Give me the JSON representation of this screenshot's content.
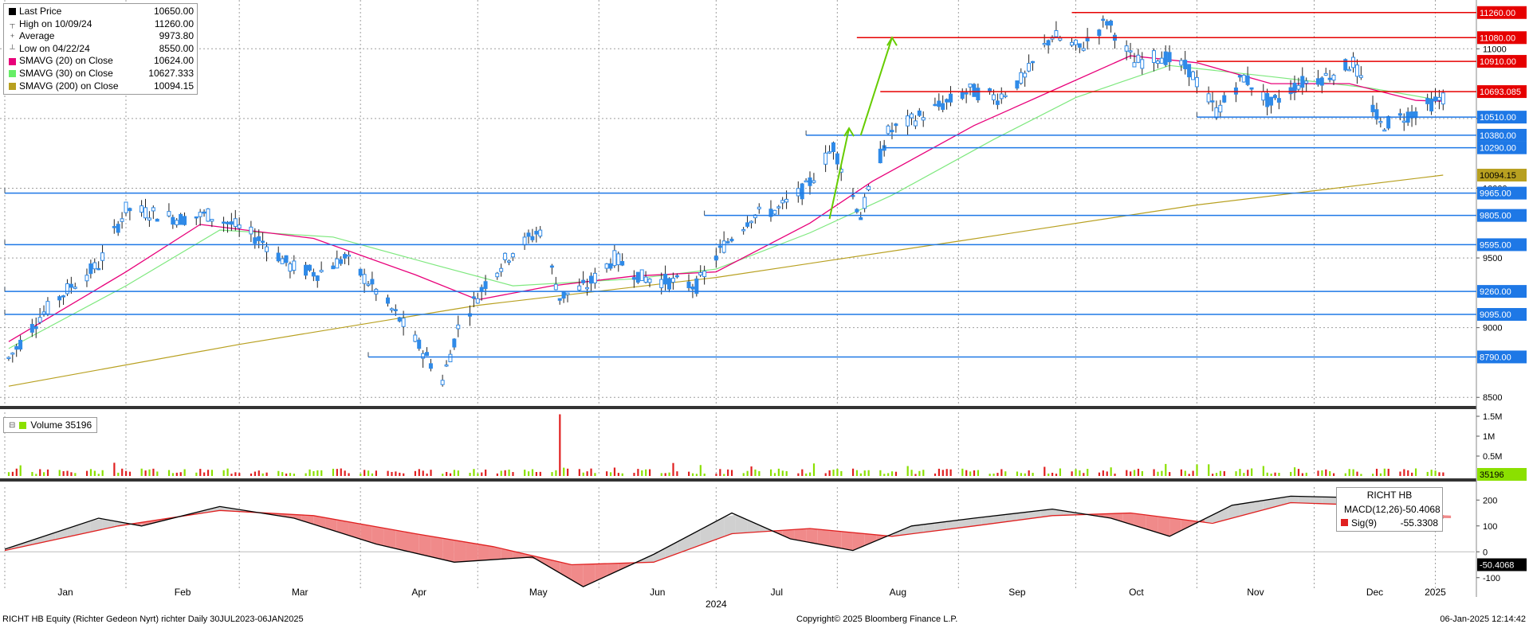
{
  "legend": {
    "items": [
      {
        "label": "Last Price",
        "value": "10650.00",
        "swatch": "#000000",
        "icon": "square"
      },
      {
        "label": "High on 10/09/24",
        "value": "11260.00",
        "icon": "high-marker-icon"
      },
      {
        "label": "Average",
        "value": "9973.80",
        "icon": "average-marker-icon"
      },
      {
        "label": "Low on 04/22/24",
        "value": "8550.00",
        "icon": "low-marker-icon"
      },
      {
        "label": "SMAVG (20)  on Close",
        "value": "10624.00",
        "swatch": "#e8007a",
        "icon": "square"
      },
      {
        "label": "SMAVG (30)  on Close",
        "value": "10627.333",
        "swatch": "#66ee66",
        "icon": "square"
      },
      {
        "label": "SMAVG (200)  on Close",
        "value": "10094.15",
        "swatch": "#b8a020",
        "icon": "square"
      }
    ]
  },
  "volume_legend": {
    "label": "Volume",
    "value": "35196"
  },
  "macd_legend": {
    "title": "RICHT HB",
    "macd_label": "MACD(12,26)",
    "macd_value": "-50.4068",
    "sig_label": "Sig(9)",
    "sig_value": "-55.3308"
  },
  "footer": {
    "left": "RICHT HB Equity (Richter Gedeon Nyrt) richter  Daily 30JUL2023-06JAN2025",
    "center": "Copyright© 2025 Bloomberg Finance L.P.",
    "right": "06-Jan-2025 12:14:42"
  },
  "colors": {
    "up": "#2f8ae8",
    "down": "#2f8ae8",
    "resistance": "#e60000",
    "support": "#1e78e6",
    "sma20": "#e8007a",
    "sma30": "#7ee87e",
    "sma200": "#b8a020",
    "arrow": "#66cc00",
    "vol_up": "#8be000",
    "vol_down": "#e02020",
    "macd": "#000000",
    "signal": "#e02020"
  },
  "chart_data": {
    "type": "candlestick",
    "x_axis": {
      "month_labels": [
        "Jan",
        "Feb",
        "Mar",
        "Apr",
        "May",
        "Jun",
        "Jul",
        "Aug",
        "Sep",
        "Oct",
        "Nov",
        "Dec"
      ],
      "year_labels": [
        "2024",
        "2025"
      ],
      "date_range": [
        "2024-01-01",
        "2025-01-06"
      ]
    },
    "price_panel": {
      "ylim": [
        8450,
        11350
      ],
      "ticks": [
        8500,
        9000,
        9500,
        10000,
        10500,
        11000
      ],
      "price_path": [
        [
          "2024-01-02",
          8780
        ],
        [
          "2024-01-10",
          9080
        ],
        [
          "2024-01-18",
          9300
        ],
        [
          "2024-01-25",
          9450
        ],
        [
          "2024-02-01",
          9850
        ],
        [
          "2024-02-08",
          9820
        ],
        [
          "2024-02-15",
          9780
        ],
        [
          "2024-02-22",
          9810
        ],
        [
          "2024-02-29",
          9730
        ],
        [
          "2024-03-07",
          9620
        ],
        [
          "2024-03-14",
          9440
        ],
        [
          "2024-03-21",
          9390
        ],
        [
          "2024-03-28",
          9500
        ],
        [
          "2024-04-04",
          9300
        ],
        [
          "2024-04-11",
          9060
        ],
        [
          "2024-04-17",
          8830
        ],
        [
          "2024-04-22",
          8620
        ],
        [
          "2024-04-26",
          9000
        ],
        [
          "2024-05-03",
          9320
        ],
        [
          "2024-05-10",
          9550
        ],
        [
          "2024-05-17",
          9700
        ],
        [
          "2024-05-22",
          9220
        ],
        [
          "2024-05-29",
          9300
        ],
        [
          "2024-06-05",
          9500
        ],
        [
          "2024-06-12",
          9360
        ],
        [
          "2024-06-19",
          9330
        ],
        [
          "2024-06-26",
          9300
        ],
        [
          "2024-07-03",
          9590
        ],
        [
          "2024-07-10",
          9800
        ],
        [
          "2024-07-17",
          9850
        ],
        [
          "2024-07-24",
          10000
        ],
        [
          "2024-07-31",
          10300
        ],
        [
          "2024-08-07",
          9800
        ],
        [
          "2024-08-14",
          10400
        ],
        [
          "2024-08-21",
          10500
        ],
        [
          "2024-08-28",
          10600
        ],
        [
          "2024-09-04",
          10700
        ],
        [
          "2024-09-11",
          10650
        ],
        [
          "2024-09-18",
          10800
        ],
        [
          "2024-09-25",
          11100
        ],
        [
          "2024-10-02",
          11000
        ],
        [
          "2024-10-09",
          11200
        ],
        [
          "2024-10-16",
          10900
        ],
        [
          "2024-10-23",
          10950
        ],
        [
          "2024-10-30",
          10850
        ],
        [
          "2024-11-06",
          10550
        ],
        [
          "2024-11-13",
          10800
        ],
        [
          "2024-11-20",
          10600
        ],
        [
          "2024-11-27",
          10750
        ],
        [
          "2024-12-04",
          10800
        ],
        [
          "2024-12-11",
          10900
        ],
        [
          "2024-12-18",
          10450
        ],
        [
          "2024-12-27",
          10550
        ],
        [
          "2025-01-03",
          10650
        ]
      ],
      "sma20_path": [
        [
          "2024-01-02",
          8900
        ],
        [
          "2024-02-01",
          9400
        ],
        [
          "2024-02-20",
          9740
        ],
        [
          "2024-03-20",
          9640
        ],
        [
          "2024-04-15",
          9380
        ],
        [
          "2024-05-01",
          9200
        ],
        [
          "2024-05-20",
          9300
        ],
        [
          "2024-06-10",
          9370
        ],
        [
          "2024-07-01",
          9400
        ],
        [
          "2024-07-25",
          9750
        ],
        [
          "2024-08-10",
          10050
        ],
        [
          "2024-09-05",
          10450
        ],
        [
          "2024-09-25",
          10700
        ],
        [
          "2024-10-15",
          10950
        ],
        [
          "2024-11-01",
          10900
        ],
        [
          "2024-11-20",
          10750
        ],
        [
          "2024-12-10",
          10750
        ],
        [
          "2024-12-27",
          10630
        ],
        [
          "2025-01-03",
          10624
        ]
      ],
      "sma30_path": [
        [
          "2024-01-02",
          8850
        ],
        [
          "2024-02-01",
          9300
        ],
        [
          "2024-02-25",
          9700
        ],
        [
          "2024-03-25",
          9650
        ],
        [
          "2024-04-20",
          9450
        ],
        [
          "2024-05-10",
          9300
        ],
        [
          "2024-06-10",
          9350
        ],
        [
          "2024-07-01",
          9420
        ],
        [
          "2024-07-25",
          9680
        ],
        [
          "2024-08-15",
          9950
        ],
        [
          "2024-09-10",
          10350
        ],
        [
          "2024-10-01",
          10650
        ],
        [
          "2024-10-25",
          10880
        ],
        [
          "2024-11-20",
          10800
        ],
        [
          "2024-12-15",
          10720
        ],
        [
          "2025-01-03",
          10627
        ]
      ],
      "sma200_path": [
        [
          "2024-01-02",
          8580
        ],
        [
          "2024-03-01",
          8880
        ],
        [
          "2024-05-01",
          9160
        ],
        [
          "2024-07-01",
          9360
        ],
        [
          "2024-09-01",
          9620
        ],
        [
          "2024-11-01",
          9880
        ],
        [
          "2025-01-03",
          10094
        ]
      ],
      "resistance_levels": [
        {
          "value": 11260.0,
          "label": "11260.00",
          "from": "2024-09-30"
        },
        {
          "value": 11080.0,
          "label": "11080.00",
          "from": "2024-08-06"
        },
        {
          "value": 10910.0,
          "label": "10910.00",
          "from": "2024-11-01"
        },
        {
          "value": 10693.085,
          "label": "10693.085",
          "from": "2024-08-12"
        }
      ],
      "support_levels": [
        {
          "value": 10510.0,
          "label": "10510.00",
          "from": "2024-11-01"
        },
        {
          "value": 10380.0,
          "label": "10380.00",
          "from": "2024-07-24"
        },
        {
          "value": 10290.0,
          "label": "10290.00",
          "from": "2024-08-13"
        },
        {
          "value": 9965.0,
          "label": "9965.00",
          "from": "2024-01-01"
        },
        {
          "value": 9805.0,
          "label": "9805.00",
          "from": "2024-06-28"
        },
        {
          "value": 9595.0,
          "label": "9595.00",
          "from": "2024-01-01"
        },
        {
          "value": 9260.0,
          "label": "9260.00",
          "from": "2024-01-01"
        },
        {
          "value": 9095.0,
          "label": "9095.00",
          "from": "2024-01-01"
        },
        {
          "value": 8790.0,
          "label": "8790.00",
          "from": "2024-04-03"
        }
      ],
      "sma200_label": "10094.15",
      "arrows": [
        {
          "from": [
            "2024-07-30",
            9780
          ],
          "to": [
            "2024-08-04",
            10430
          ]
        },
        {
          "from": [
            "2024-08-07",
            10380
          ],
          "to": [
            "2024-08-15",
            11080
          ]
        }
      ]
    },
    "volume_panel": {
      "ticks": [
        "0.5M",
        "1M",
        "1.5M"
      ],
      "tick_values": [
        0.5,
        1.0,
        1.5
      ],
      "ylim": [
        0,
        1.6
      ],
      "last_label": "35196",
      "spikes": [
        {
          "date": "2024-05-22",
          "value": 1.55
        }
      ]
    },
    "macd_panel": {
      "ylim": [
        -150,
        250
      ],
      "ticks": [
        "-100",
        "0",
        "100",
        "200"
      ],
      "tick_values": [
        -100,
        0,
        100,
        200
      ],
      "last_label": "-50.4068",
      "macd_path": [
        [
          "2024-01-01",
          10
        ],
        [
          "2024-01-25",
          130
        ],
        [
          "2024-02-05",
          100
        ],
        [
          "2024-02-25",
          175
        ],
        [
          "2024-03-15",
          130
        ],
        [
          "2024-04-05",
          30
        ],
        [
          "2024-04-25",
          -40
        ],
        [
          "2024-05-15",
          -20
        ],
        [
          "2024-05-28",
          -135
        ],
        [
          "2024-06-15",
          -10
        ],
        [
          "2024-07-05",
          150
        ],
        [
          "2024-07-20",
          50
        ],
        [
          "2024-08-05",
          5
        ],
        [
          "2024-08-20",
          100
        ],
        [
          "2024-09-05",
          130
        ],
        [
          "2024-09-25",
          165
        ],
        [
          "2024-10-10",
          130
        ],
        [
          "2024-10-25",
          60
        ],
        [
          "2024-11-10",
          180
        ],
        [
          "2024-11-25",
          215
        ],
        [
          "2024-12-10",
          210
        ],
        [
          "2024-12-20",
          140
        ],
        [
          "2025-01-03",
          130
        ]
      ],
      "signal_path": [
        [
          "2024-01-01",
          5
        ],
        [
          "2024-01-30",
          100
        ],
        [
          "2024-02-25",
          160
        ],
        [
          "2024-03-20",
          140
        ],
        [
          "2024-04-15",
          70
        ],
        [
          "2024-05-05",
          20
        ],
        [
          "2024-05-25",
          -50
        ],
        [
          "2024-06-15",
          -40
        ],
        [
          "2024-07-05",
          70
        ],
        [
          "2024-07-25",
          90
        ],
        [
          "2024-08-15",
          60
        ],
        [
          "2024-09-05",
          100
        ],
        [
          "2024-09-25",
          140
        ],
        [
          "2024-10-15",
          150
        ],
        [
          "2024-11-05",
          110
        ],
        [
          "2024-11-25",
          190
        ],
        [
          "2024-12-15",
          180
        ],
        [
          "2025-01-03",
          140
        ]
      ]
    }
  }
}
